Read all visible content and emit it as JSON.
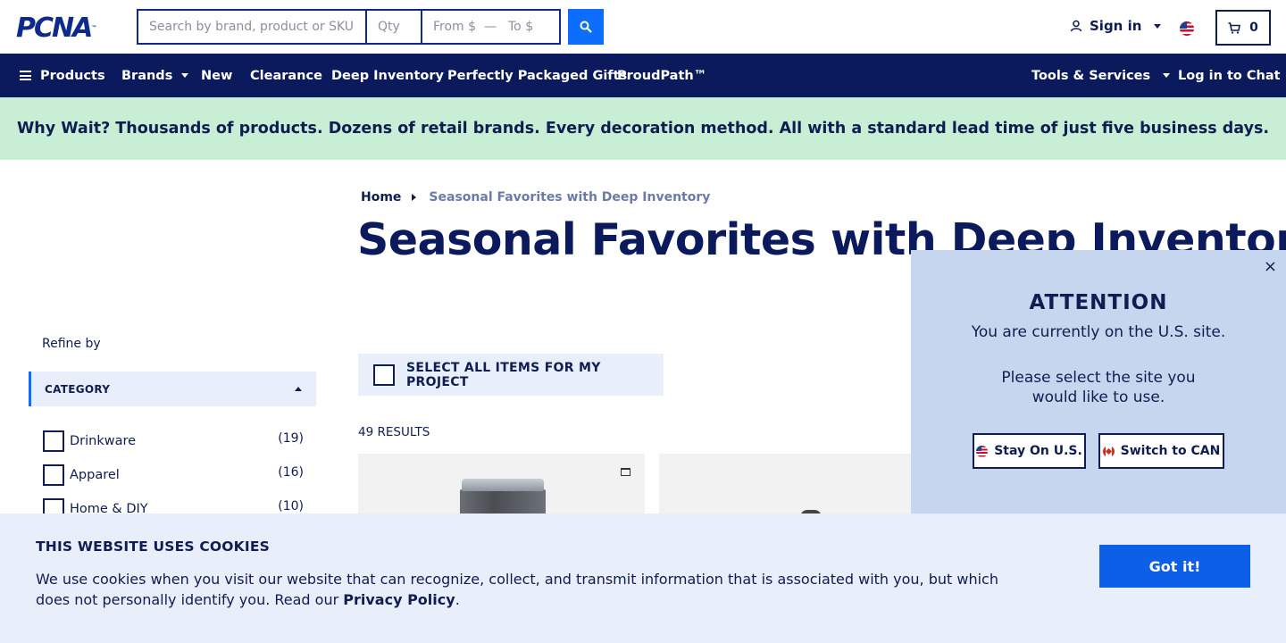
{
  "header": {
    "logo_text": "PCNA",
    "logo_tm": "™",
    "search_placeholder": "Search by brand, product or SKU",
    "qty_placeholder": "Qty",
    "from_placeholder": "From $",
    "to_placeholder": "To $",
    "search_icon": "search-icon",
    "signin_label": "Sign in",
    "cart_count": "0"
  },
  "nav": {
    "products": "Products",
    "brands": "Brands",
    "new": "New",
    "clearance": "Clearance",
    "deep_inventory": "Deep Inventory",
    "gifts": "Perfectly Packaged Gifts",
    "proudpath": "ProudPath™",
    "tools": "Tools & Services",
    "chat": "Log in to Chat"
  },
  "promo": {
    "text": "Why Wait? Thousands of products. Dozens of retail brands. Every decoration method. All with a standard lead time of just five business days."
  },
  "breadcrumb": {
    "home": "Home",
    "current": "Seasonal Favorites with Deep Inventory"
  },
  "page": {
    "title": "Seasonal Favorites with Deep Inventory",
    "select_all": "SELECT ALL ITEMS FOR MY PROJECT",
    "results": "49 RESULTS"
  },
  "sidebar": {
    "refine": "Refine by",
    "category_header": "CATEGORY",
    "categories": [
      {
        "label": "Drinkware",
        "count": "(19)"
      },
      {
        "label": "Apparel",
        "count": "(16)"
      },
      {
        "label": "Home & DIY",
        "count": "(10)"
      }
    ]
  },
  "popup": {
    "close": "×",
    "title": "ATTENTION",
    "line1": "You are currently on the U.S. site.",
    "line2": "Please select the site you would like to use.",
    "stay": "Stay On U.S.",
    "switch": "Switch to CAN"
  },
  "cookie": {
    "title": "THIS WEBSITE USES COOKIES",
    "text": "We use cookies when you visit our website that can recognize, collect, and transmit information that is associated with you, but which does not personally identify you. Read our ",
    "link": "Privacy Policy",
    "end": ".",
    "button": "Got it!"
  },
  "colors": {
    "navy": "#0a1a5c",
    "accent_blue": "#0d6efd",
    "promo_green": "#c8efd6",
    "popup_bg": "#c7d6ef",
    "cookie_bg": "#e9eefb"
  }
}
